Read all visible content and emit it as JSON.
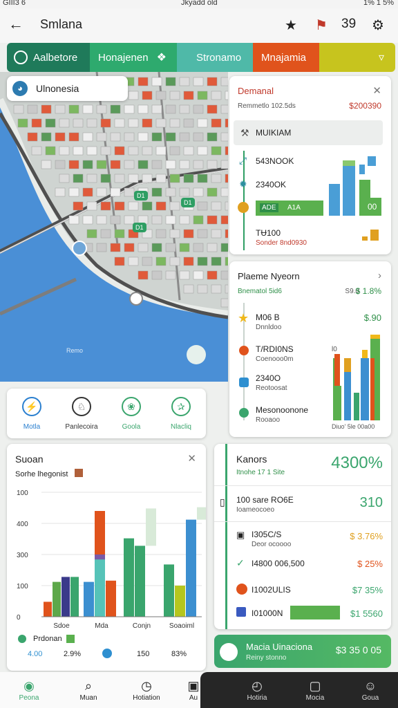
{
  "status": {
    "left": "GIII3 6",
    "middle": "Jkyadd old",
    "right": "1% 1 5%"
  },
  "appbar": {
    "title": "Smlana",
    "count": "39"
  },
  "tabs": [
    {
      "label": "Aalbetore",
      "color": "#1f7a5a"
    },
    {
      "label": "Honajenen",
      "color": "#2eaa6e"
    },
    {
      "label": "Stronamo",
      "color": "#4fb9a8"
    },
    {
      "label": "Mnajamia",
      "color": "#e0531c"
    },
    {
      "label": "",
      "color": "#c7c41e"
    }
  ],
  "map": {
    "chip_label": "Ulnonesia",
    "water_label": "Remo",
    "pins": [
      "D1",
      "D1",
      "D1"
    ]
  },
  "card1": {
    "title": "Demanal",
    "subtitle": "Remmetlo 102.5ds",
    "amount": "$200390",
    "search_label": "MUIKIAM",
    "rows": [
      {
        "label": "543NOOK",
        "icon_color": "#2e8fa0"
      },
      {
        "label": "2340OK",
        "icon_color": "#2e8fa0"
      },
      {
        "label": "",
        "bar_left": "ADE",
        "bar_right": "A1A",
        "icon_color": "#e0a020"
      },
      {
        "label": "TɄ100",
        "sub": "Sonder 8nd0930"
      }
    ],
    "bar_value_label": "00"
  },
  "card2": {
    "title": "Plaeme Nyeorn",
    "subtitle": "Bnematol 5id6",
    "amount": "$ 1.8%",
    "amount_prefix": "S9.0",
    "rows": [
      {
        "title": "M06 B",
        "sub": "Dnnldoo",
        "value": "$.90",
        "icon": "star",
        "icon_color": "#f0b81a"
      },
      {
        "title": "T/RDI0NS",
        "sub": "Coenooo0m",
        "value": "",
        "icon": "pin",
        "icon_color": "#e0531c"
      },
      {
        "title": "2340O",
        "sub": "Reotoosat",
        "value": "",
        "icon": "square",
        "icon_color": "#2e8fd0"
      },
      {
        "title": "Mesonoonone",
        "sub": "Rooaoo",
        "value": "",
        "icon": "triangle",
        "icon_color": "#3aa56d"
      }
    ],
    "chart_label": "Diuo' 5le 00a00",
    "chart_top": "l0"
  },
  "quick": [
    {
      "label": "Motla",
      "icon_color": "#2a7fcf",
      "glyph": "⚡"
    },
    {
      "label": "Panlecoira",
      "icon_color": "#333333",
      "glyph": "♘"
    },
    {
      "label": "Goola",
      "icon_color": "#3aa56d",
      "glyph": "❀"
    },
    {
      "label": "Nlacliq",
      "icon_color": "#3aa56d",
      "glyph": "✰"
    }
  ],
  "card3": {
    "title": "Suoan",
    "subtitle": "Sorhe lhegonist",
    "legend_label": "Prdonan",
    "stats": [
      "4.00",
      "2.9%",
      "150",
      "83%"
    ]
  },
  "chart_data": {
    "type": "bar",
    "categories": [
      "Sdoe",
      "Mda",
      "Conjn",
      "Soaoiml"
    ],
    "yticks": [
      "100",
      "400",
      "300",
      "100",
      "0"
    ],
    "ylim": [
      0,
      100
    ],
    "bars": [
      {
        "category": 0,
        "color": "#e0531c",
        "value": 12
      },
      {
        "category": 0,
        "color": "#5da84a",
        "value": 28
      },
      {
        "category": 0,
        "color": "#3a3a8a",
        "value": 32
      },
      {
        "category": 0,
        "color": "#3aa56d",
        "value": 32
      },
      {
        "category": 1,
        "color": "#3c8fd0",
        "value": 28
      },
      {
        "category": 1,
        "color": "#7b5aa6",
        "value": 50,
        "base": 28
      },
      {
        "category": 1,
        "color": "#e0531c",
        "value": 85,
        "base": 50
      },
      {
        "category": 1,
        "color": "#56c3b8",
        "value": 46
      },
      {
        "category": 1,
        "color": "#e0531c",
        "value": 29
      },
      {
        "category": 2,
        "color": "#3aa56d",
        "value": 63
      },
      {
        "category": 2,
        "color": "#3aa56d",
        "value": 57
      },
      {
        "category": 2,
        "color": "#d8ead8",
        "value": 87,
        "base": 57
      },
      {
        "category": 3,
        "color": "#3aa56d",
        "value": 42
      },
      {
        "category": 3,
        "color": "#b5c61e",
        "value": 25
      },
      {
        "category": 3,
        "color": "#3c8fd0",
        "value": 78
      },
      {
        "category": 3,
        "color": "#d8ead8",
        "value": 88,
        "base": 78
      }
    ]
  },
  "card4": {
    "title": "Kanors",
    "subtitle": "Itnohe 17 1 Site",
    "big": "4300%",
    "rows": [
      {
        "title": "100 sare RO6E",
        "sub": "Ioameocoeo",
        "value": "310",
        "value_color": "#3aa56d",
        "icon": "phone"
      },
      {
        "title": "I305C/S",
        "sub": "Deor ocoooo",
        "value": "$ 3.76%",
        "value_color": "#e0a020",
        "icon": "cart"
      },
      {
        "title": "I4800 006,500",
        "sub": "",
        "value": "$ 25%",
        "value_color": "#e0531c",
        "icon": "bird"
      },
      {
        "title": "I1002ULIS",
        "sub": "",
        "value": "$7 35%",
        "value_color": "#3aa56d",
        "icon": "tag"
      },
      {
        "title": "I01000N",
        "sub": "",
        "value": "$1 5560",
        "value_color": "#3aa56d",
        "icon": "box"
      }
    ]
  },
  "banner": {
    "title": "Macia Uinaciona",
    "sub": "Reiny stonno",
    "amount": "$3 35 0 05"
  },
  "nav": [
    {
      "label": "Peona",
      "glyph": "◉"
    },
    {
      "label": "Muan",
      "glyph": "⌕"
    },
    {
      "label": "Hotiation",
      "glyph": "◷"
    },
    {
      "label": "Au",
      "glyph": "▣"
    },
    {
      "label": "Hotiria",
      "glyph": "◴"
    },
    {
      "label": "Mocia",
      "glyph": "▢"
    },
    {
      "label": "Goua",
      "glyph": "☺"
    }
  ]
}
